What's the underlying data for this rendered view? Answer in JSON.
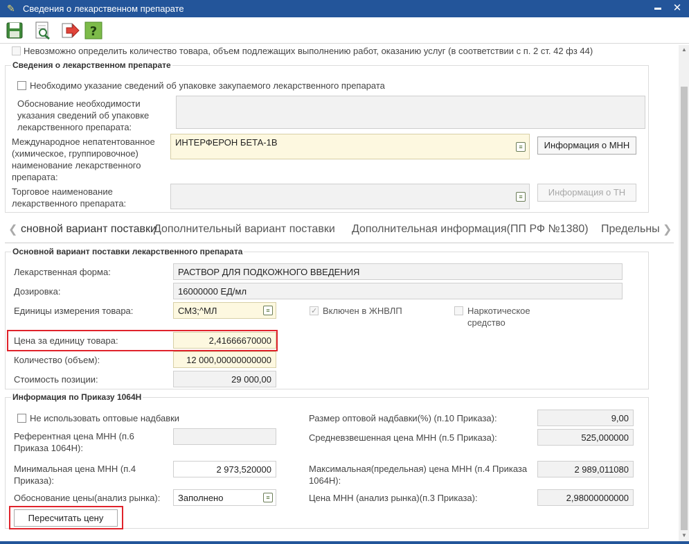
{
  "window": {
    "title": "Сведения о лекарственном препарате",
    "minimize_label": "▬",
    "close_label": "✕"
  },
  "toolbar": {
    "icons": [
      "save-icon",
      "preview-icon",
      "export-icon",
      "help-icon"
    ]
  },
  "top_checkbox_label": "Невозможно определить количество товара, объем подлежащих выполнению работ, оказанию услуг (в соответствии с п. 2 ст. 42 фз 44)",
  "drug_info": {
    "legend": "Сведения о лекарственном препарате",
    "packaging_checkbox_label": "Необходимо указание сведений об упаковке закупаемого лекарственного препарата",
    "packaging_reason_label": "Обоснование необходимости указания сведений об упаковке лекарственного препарата:",
    "packaging_reason_value": "",
    "mnn_label": "Международное непатентованное (химическое, группировочное) наименование лекарственного препарата:",
    "mnn_value": "ИНТЕРФЕРОН БЕТА-1B",
    "mnn_button": "Информация о МНН",
    "trade_name_label": "Торговое наименование лекарственного препарата:",
    "trade_name_value": "",
    "tn_button": "Информация о ТН"
  },
  "tabs": [
    {
      "label": "сновной вариант поставки",
      "active": true
    },
    {
      "label": "Дополнительный вариант поставки",
      "active": false
    },
    {
      "label": "Дополнительная информация(ПП РФ №1380)",
      "active": false
    },
    {
      "label": "Предельны",
      "active": false
    }
  ],
  "tab_arrows": {
    "left": "❮",
    "right": "❯"
  },
  "main_variant": {
    "legend": "Основной вариант поставки лекарственного препарата",
    "form_label": "Лекарственная форма:",
    "form_value": "РАСТВОР ДЛЯ ПОДКОЖНОГО ВВЕДЕНИЯ",
    "dosage_label": "Дозировка:",
    "dosage_value": "16000000 ЕД/мл",
    "units_label": "Единицы измерения товара:",
    "units_value": "СМ3;^МЛ",
    "zhnvlp_label": "Включен в ЖНВЛП",
    "zhnvlp_checked": true,
    "narcotic_label_1": "Наркотическое",
    "narcotic_label_2": "средство",
    "narcotic_checked": false,
    "price_label": "Цена за единицу товара:",
    "price_value": "2,41666670000",
    "qty_label": "Количество (объем):",
    "qty_value": "12 000,00000000000",
    "cost_label": "Стоимость позиции:",
    "cost_value": "29 000,00"
  },
  "order_1064": {
    "legend": "Информация по Приказу 1064Н",
    "no_wholesale_label": "Не использовать оптовые надбавки",
    "ref_price_label": "Референтная цена МНН (п.6 Приказа 1064Н):",
    "ref_price_value": "",
    "min_price_label": "Минимальная цена МНН (п.4 Приказа):",
    "min_price_value": "2 973,520000",
    "price_reason_label": "Обоснование цены(анализ рынка):",
    "price_reason_value": "Заполнено",
    "wholesale_markup_label": "Размер оптовой надбавки(%) (п.10 Приказа):",
    "wholesale_markup_value": "9,00",
    "weighted_price_label": "Средневзвешенная цена МНН (п.5 Приказа):",
    "weighted_price_value": "525,000000",
    "max_price_label": "Максимальная(предельная) цена МНН (п.4 Приказа 1064Н):",
    "max_price_value": "2 989,011080",
    "market_price_label": "Цена МНН (анализ рынка)(п.3 Приказа):",
    "market_price_value": "2,98000000000",
    "recalc_button": "Пересчитать цену"
  },
  "colors": {
    "titlebar": "#23559a",
    "highlight": "#e0232b",
    "required_field": "#fdf8e0"
  }
}
